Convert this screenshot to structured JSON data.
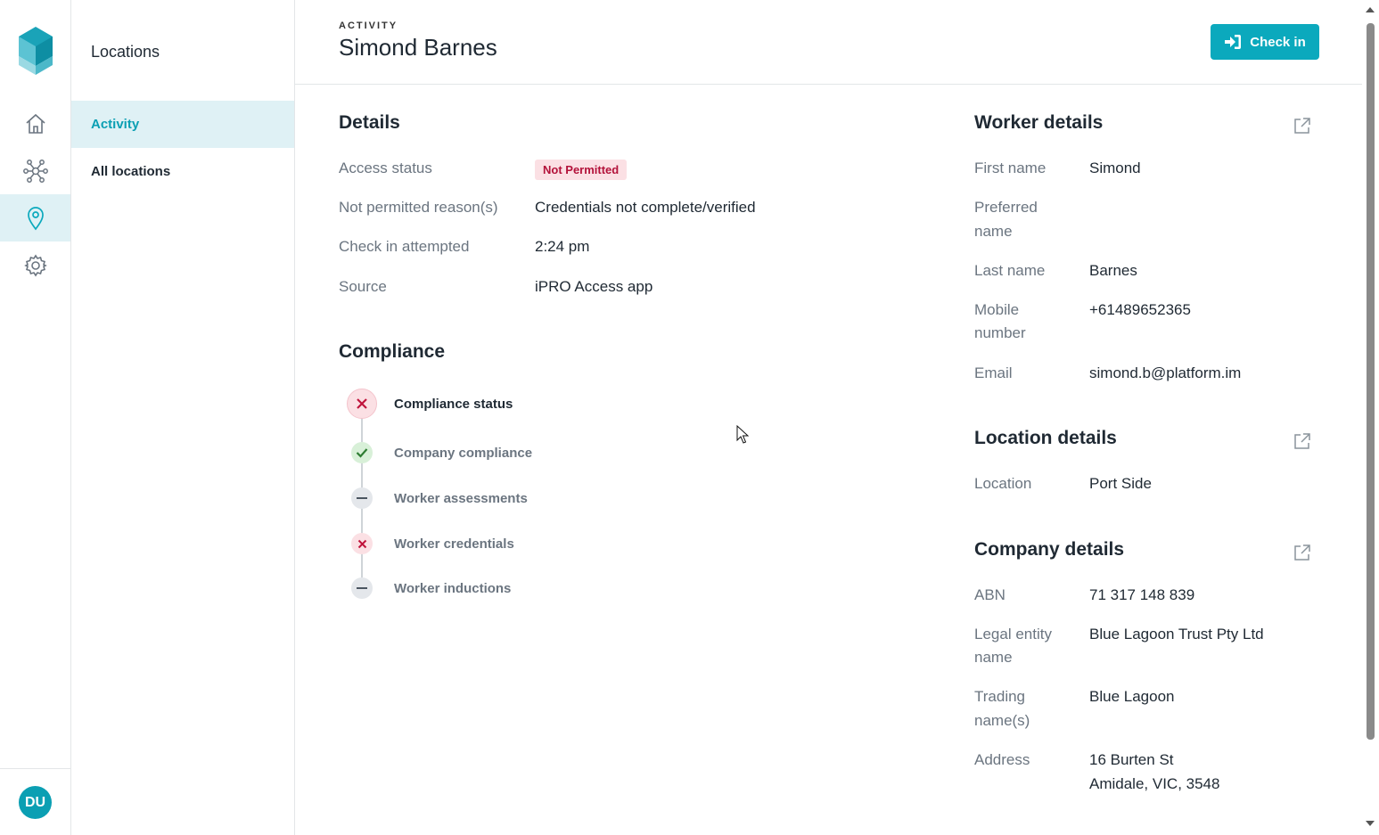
{
  "nav": {
    "rail": [
      {
        "name": "home-icon"
      },
      {
        "name": "network-icon"
      },
      {
        "name": "location-pin-icon"
      },
      {
        "name": "gear-icon"
      }
    ],
    "avatar_initials": "DU",
    "accent": "#0ba9bd"
  },
  "subnav": {
    "title": "Locations",
    "items": [
      "Activity",
      "All locations"
    ],
    "active": "Activity"
  },
  "header": {
    "eyebrow": "ACTIVITY",
    "title": "Simond Barnes",
    "checkin_label": "Check in"
  },
  "details": {
    "heading": "Details",
    "rows": [
      {
        "label": "Access status",
        "value": "Not Permitted"
      },
      {
        "label": "Not permitted reason(s)",
        "value": "Credentials not complete/verified"
      },
      {
        "label": "Check in attempted",
        "value": "2:24 pm"
      },
      {
        "label": "Source",
        "value": "iPRO Access app"
      }
    ]
  },
  "compliance": {
    "heading": "Compliance",
    "items": [
      {
        "label": "Compliance status",
        "state": "fail"
      },
      {
        "label": "Company compliance",
        "state": "pass"
      },
      {
        "label": "Worker assessments",
        "state": "none"
      },
      {
        "label": "Worker credentials",
        "state": "fail"
      },
      {
        "label": "Worker inductions",
        "state": "none"
      }
    ]
  },
  "worker": {
    "heading": "Worker details",
    "first_name_label": "First name",
    "first_name": "Simond",
    "preferred_label_1": "Preferred",
    "preferred_label_2": "name",
    "preferred": "",
    "last_name_label": "Last name",
    "last_name": "Barnes",
    "mobile_label_1": "Mobile",
    "mobile_label_2": "number",
    "mobile": "+61489652365",
    "email_label": "Email",
    "email": "simond.b@platform.im"
  },
  "location": {
    "heading": "Location details",
    "location_label": "Location",
    "location": "Port Side"
  },
  "company": {
    "heading": "Company details",
    "abn_label": "ABN",
    "abn": "71 317 148 839",
    "legal_label_1": "Legal entity",
    "legal_label_2": "name",
    "legal": "Blue Lagoon Trust Pty Ltd",
    "trading_label_1": "Trading",
    "trading_label_2": "name(s)",
    "trading": "Blue Lagoon",
    "address_label": "Address",
    "address_1": "16 Burten St",
    "address_2": "Amidale, VIC, 3548"
  }
}
